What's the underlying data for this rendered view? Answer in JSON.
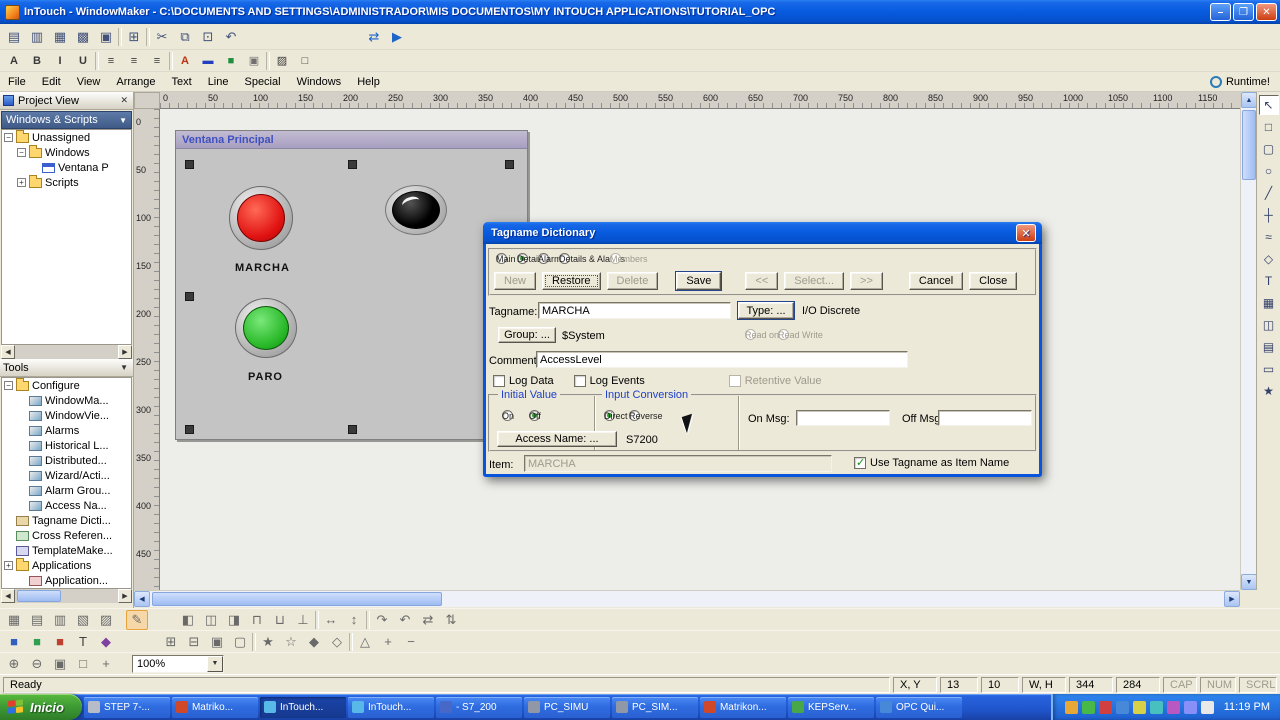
{
  "titlebar": {
    "title": "InTouch - WindowMaker - C:\\DOCUMENTS AND SETTINGS\\ADMINISTRADOR\\MIS DOCUMENTOS\\MY INTOUCH APPLICATIONS\\TUTORIAL_OPC",
    "minimize_glyph": "–",
    "maximize_glyph": "❐",
    "close_glyph": "✕"
  },
  "toolbar1": {
    "icons": [
      {
        "name": "new-window-icon",
        "glyph": "▤"
      },
      {
        "name": "open-window-icon",
        "glyph": "▥"
      },
      {
        "name": "save-window-icon",
        "glyph": "▦"
      },
      {
        "name": "save-all-icon",
        "glyph": "▩"
      },
      {
        "name": "close-window-icon",
        "glyph": "▣"
      },
      {
        "name": "toolbar-separator",
        "sep": true
      },
      {
        "name": "print-icon",
        "glyph": "⊞"
      },
      {
        "name": "toolbar-separator",
        "sep": true
      },
      {
        "name": "cut-icon",
        "glyph": "✂"
      },
      {
        "name": "copy-icon",
        "glyph": "⧉"
      },
      {
        "name": "paste-icon",
        "glyph": "⊡"
      },
      {
        "name": "undo-icon",
        "glyph": "↶"
      },
      {
        "name": "transfer-to-viewer-icon",
        "glyph": "⇄",
        "gap": 120,
        "color": "#1b64c8"
      },
      {
        "name": "runtime-fast-switch-icon",
        "glyph": "▶",
        "color": "#1b64c8"
      }
    ]
  },
  "toolbar2": {
    "icons": [
      {
        "name": "font-icon",
        "glyph": "A"
      },
      {
        "name": "bold-icon",
        "glyph": "B"
      },
      {
        "name": "italic-icon",
        "glyph": "I"
      },
      {
        "name": "underline-icon",
        "glyph": "U"
      },
      {
        "name": "toolbar-separator",
        "sep": true
      },
      {
        "name": "align-left-icon",
        "glyph": "≡"
      },
      {
        "name": "align-center-icon",
        "glyph": "≡"
      },
      {
        "name": "align-right-icon",
        "glyph": "≡"
      },
      {
        "name": "toolbar-separator",
        "sep": true
      },
      {
        "name": "text-color-icon",
        "glyph": "A",
        "color": "#c03010"
      },
      {
        "name": "line-color-icon",
        "glyph": "▬",
        "color": "#2040c0"
      },
      {
        "name": "fill-color-icon",
        "glyph": "■",
        "color": "#209040"
      },
      {
        "name": "window-color-icon",
        "glyph": "▣",
        "color": "#707070"
      },
      {
        "name": "toolbar-separator",
        "sep": true
      },
      {
        "name": "pattern-icon",
        "glyph": "▨"
      },
      {
        "name": "transparent-icon",
        "glyph": "□"
      }
    ]
  },
  "menubar": {
    "items": [
      "File",
      "Edit",
      "View",
      "Arrange",
      "Text",
      "Line",
      "Special",
      "Windows",
      "Help"
    ],
    "runtime_label": "Runtime!"
  },
  "project_view": {
    "title": "Project View",
    "close_glyph": "✕",
    "selector": "Windows & Scripts",
    "items": [
      {
        "label": "Unassigned",
        "indent": 0,
        "icon": "folder",
        "expand": "minus"
      },
      {
        "label": "Windows",
        "indent": 1,
        "icon": "folder",
        "expand": "minus"
      },
      {
        "label": "Ventana P",
        "indent": 2,
        "icon": "window"
      },
      {
        "label": "Scripts",
        "indent": 1,
        "icon": "folder",
        "expand": "plus"
      }
    ]
  },
  "tools_panel": {
    "title": "Tools",
    "items": [
      {
        "label": "Configure",
        "indent": 0,
        "icon": "folder",
        "expand": "minus"
      },
      {
        "label": "WindowMa...",
        "indent": 1,
        "icon": "wizard"
      },
      {
        "label": "WindowVie...",
        "indent": 1,
        "icon": "wizard"
      },
      {
        "label": "Alarms",
        "indent": 1,
        "icon": "wizard"
      },
      {
        "label": "Historical L...",
        "indent": 1,
        "icon": "wizard"
      },
      {
        "label": "Distributed...",
        "indent": 1,
        "icon": "wizard"
      },
      {
        "label": "Wizard/Acti...",
        "indent": 1,
        "icon": "wizard"
      },
      {
        "label": "Alarm Grou...",
        "indent": 1,
        "icon": "wizard"
      },
      {
        "label": "Access Na...",
        "indent": 1,
        "icon": "wizard"
      },
      {
        "label": "Tagname Dicti...",
        "indent": 0,
        "icon": "dict"
      },
      {
        "label": "Cross Referen...",
        "indent": 0,
        "icon": "cross"
      },
      {
        "label": "TemplateMake...",
        "indent": 0,
        "icon": "template"
      },
      {
        "label": "Applications",
        "indent": 0,
        "icon": "folder",
        "expand": "plus"
      },
      {
        "label": "Application...",
        "indent": 1,
        "icon": "app"
      }
    ]
  },
  "ruler_h": [
    "0",
    "50",
    "100",
    "150",
    "200",
    "250",
    "300",
    "350",
    "400",
    "450",
    "500",
    "550",
    "600",
    "650",
    "700",
    "750",
    "800",
    "850",
    "900",
    "950",
    "1000",
    "1050",
    "1100",
    "1150"
  ],
  "ruler_v": [
    "0",
    "50",
    "100",
    "150",
    "200",
    "250",
    "300",
    "350",
    "400",
    "450"
  ],
  "design_window": {
    "title": "Ventana Principal",
    "marcha_label": "MARCHA",
    "paro_label": "PARO"
  },
  "palette": {
    "tools": [
      {
        "name": "select-tool",
        "glyph": "↖",
        "selected": true
      },
      {
        "name": "rectangle-tool",
        "glyph": "□"
      },
      {
        "name": "rounded-rectangle-tool",
        "glyph": "▢"
      },
      {
        "name": "ellipse-tool",
        "glyph": "○"
      },
      {
        "name": "line-tool",
        "glyph": "╱"
      },
      {
        "name": "hv-line-tool",
        "glyph": "┼"
      },
      {
        "name": "polyline-tool",
        "glyph": "≈"
      },
      {
        "name": "polygon-tool",
        "glyph": "◇"
      },
      {
        "name": "text-tool",
        "glyph": "T"
      },
      {
        "name": "bitmap-tool",
        "glyph": "▦"
      },
      {
        "name": "real-time-trend-tool",
        "glyph": "◫"
      },
      {
        "name": "historical-trend-tool",
        "glyph": "▤"
      },
      {
        "name": "button-tool",
        "glyph": "▭"
      },
      {
        "name": "wizard-tool",
        "glyph": "★"
      }
    ]
  },
  "dialog": {
    "title": "Tagname Dictionary",
    "close_glyph": "✕",
    "view_radios": [
      {
        "name": "main-radio",
        "label": "Main"
      },
      {
        "name": "details-radio",
        "label": "Details",
        "selected": true
      },
      {
        "name": "alarms-radio",
        "label": "Alarms"
      },
      {
        "name": "details-alarms-radio",
        "label": "Details & Alarms"
      },
      {
        "name": "members-radio",
        "label": "Members",
        "disabled": true,
        "gap": 30
      }
    ],
    "action_buttons": [
      {
        "name": "new-button",
        "label": "New",
        "disabled": true
      },
      {
        "name": "restore-button",
        "label": "Restore",
        "focus": true
      },
      {
        "name": "delete-button",
        "label": "Delete",
        "disabled": true
      },
      {
        "name": "save-button",
        "label": "Save",
        "default": true,
        "gap": 12
      },
      {
        "name": "prev-button",
        "label": "<<",
        "disabled": true,
        "gap": 18
      },
      {
        "name": "select-button",
        "label": "Select...",
        "disabled": true
      },
      {
        "name": "next-button",
        "label": ">>",
        "disabled": true
      },
      {
        "name": "cancel-button",
        "label": "Cancel",
        "gap": 20
      },
      {
        "name": "close-button",
        "label": "Close"
      }
    ],
    "tagname_label": "Tagname:",
    "tagname_value": "MARCHA",
    "type_button_label": "Type: ...",
    "type_value": "I/O Discrete",
    "group_button_label": "Group: ...",
    "group_value": "$System",
    "access_radios": [
      {
        "name": "read-only-radio",
        "label": "Read only",
        "disabled": true
      },
      {
        "name": "read-write-radio",
        "label": "Read Write",
        "disabled": true
      }
    ],
    "comment_label": "Comment:",
    "comment_value": "AccessLevel",
    "flag_checkboxes": [
      {
        "name": "log-data-checkbox",
        "label": "Log Data"
      },
      {
        "name": "log-events-checkbox",
        "label": "Log Events"
      },
      {
        "name": "retentive-value-checkbox",
        "label": "Retentive Value",
        "disabled": true,
        "gap": 64
      }
    ],
    "initial_value_label": "Initial Value",
    "initial_radios": [
      {
        "name": "on-radio",
        "label": "On"
      },
      {
        "name": "off-radio",
        "label": "Off",
        "selected": true
      }
    ],
    "input_conversion_label": "Input Conversion",
    "conversion_radios": [
      {
        "name": "direct-radio",
        "label": "Direct",
        "selected": true
      },
      {
        "name": "reverse-radio",
        "label": "Reverse"
      }
    ],
    "on_msg_label": "On Msg:",
    "on_msg_value": "",
    "off_msg_label": "Off Msg:",
    "off_msg_value": "",
    "access_name_button_label": "Access Name: ...",
    "access_name_value": "S7200",
    "item_label": "Item:",
    "item_value": "MARCHA",
    "use_tagname_label": "Use Tagname as Item Name"
  },
  "bottom_toolbar1": {
    "icons": [
      {
        "name": "snap-grid-icon",
        "glyph": "▦"
      },
      {
        "name": "grid-icon",
        "glyph": "▤"
      },
      {
        "name": "ruler-toggle-icon",
        "glyph": "▥"
      },
      {
        "name": "guides-icon",
        "glyph": "▧"
      },
      {
        "name": "layout-icon",
        "glyph": "▨"
      },
      {
        "name": "wizard-edit-icon",
        "glyph": "✎",
        "hl": true,
        "gap": 8
      },
      {
        "name": "align-left-icon",
        "glyph": "◧",
        "gap": 28
      },
      {
        "name": "align-center-icon",
        "glyph": "◫"
      },
      {
        "name": "align-right-icon",
        "glyph": "◨"
      },
      {
        "name": "align-top-icon",
        "glyph": "⊓"
      },
      {
        "name": "align-middle-icon",
        "glyph": "⊔"
      },
      {
        "name": "align-bottom-icon",
        "glyph": "⊥"
      },
      {
        "name": "toolbar-separator",
        "sep": true
      },
      {
        "name": "space-horizontal-icon",
        "glyph": "↔"
      },
      {
        "name": "space-vertical-icon",
        "glyph": "↕"
      },
      {
        "name": "toolbar-separator",
        "sep": true
      },
      {
        "name": "rotate-cw-icon",
        "glyph": "↷"
      },
      {
        "name": "rotate-ccw-icon",
        "glyph": "↶"
      },
      {
        "name": "flip-horizontal-icon",
        "glyph": "⇄"
      },
      {
        "name": "flip-vertical-icon",
        "glyph": "⇅"
      }
    ]
  },
  "bottom_toolbar2": {
    "icons": [
      {
        "name": "draw-mode-icon",
        "glyph": "■",
        "color": "#3060c0"
      },
      {
        "name": "fill-mode-icon",
        "glyph": "■",
        "color": "#30a050"
      },
      {
        "name": "line-mode-icon",
        "glyph": "■",
        "color": "#c04030"
      },
      {
        "name": "text-mode-icon",
        "glyph": "T",
        "color": "#404040"
      },
      {
        "name": "object-mode-icon",
        "glyph": "◆",
        "color": "#8040a0"
      },
      {
        "name": "bring-to-front-icon",
        "glyph": "⊞",
        "gap": 42
      },
      {
        "name": "send-to-back-icon",
        "glyph": "⊟"
      },
      {
        "name": "group-symbol-icon",
        "glyph": "▣"
      },
      {
        "name": "ungroup-symbol-icon",
        "glyph": "▢"
      },
      {
        "name": "toolbar-separator",
        "sep": true
      },
      {
        "name": "make-symbol-icon",
        "glyph": "★"
      },
      {
        "name": "break-symbol-icon",
        "glyph": "☆"
      },
      {
        "name": "make-cell-icon",
        "glyph": "◆"
      },
      {
        "name": "break-cell-icon",
        "glyph": "◇"
      },
      {
        "name": "toolbar-separator",
        "sep": true
      },
      {
        "name": "reshape-icon",
        "glyph": "△"
      },
      {
        "name": "add-point-icon",
        "glyph": "+"
      },
      {
        "name": "delete-point-icon",
        "glyph": "−"
      }
    ]
  },
  "zoom_toolbar": {
    "icons": [
      {
        "name": "zoom-in-icon",
        "glyph": "⊕"
      },
      {
        "name": "zoom-out-icon",
        "glyph": "⊖"
      },
      {
        "name": "zoom-selection-icon",
        "glyph": "▣"
      },
      {
        "name": "zoom-page-icon",
        "glyph": "□"
      },
      {
        "name": "pan-icon",
        "glyph": "+"
      }
    ],
    "zoom_value": "100%"
  },
  "statusbar": {
    "ready": "Ready",
    "xy_label": "X, Y",
    "x": "13",
    "y": "10",
    "wh_label": "W, H",
    "w": "344",
    "h": "284",
    "cap": "CAP",
    "num": "NUM",
    "scrl": "SCRL"
  },
  "taskbar": {
    "start_label": "Inicio",
    "tasks": [
      {
        "name": "task-step7",
        "label": "STEP 7-...",
        "color": "#b8bcc8"
      },
      {
        "name": "task-matrikon-1",
        "label": "Matriko...",
        "color": "#d04828"
      },
      {
        "name": "task-intouch-windowmaker",
        "label": "InTouch...",
        "color": "#58b8e8",
        "pressed": true
      },
      {
        "name": "task-intouch-2",
        "label": "InTouch...",
        "color": "#58b8e8"
      },
      {
        "name": "task-s7-200",
        "label": "- S7_200",
        "color": "#4868c8"
      },
      {
        "name": "task-pc-simu",
        "label": "PC_SIMU",
        "color": "#9098a8"
      },
      {
        "name": "task-pc-sim",
        "label": "PC_SIM...",
        "color": "#9098a8"
      },
      {
        "name": "task-matrikon-2",
        "label": "Matrikon...",
        "color": "#d04828"
      },
      {
        "name": "task-kepserver",
        "label": "KEPServ...",
        "color": "#48a848"
      },
      {
        "name": "task-opc-quick",
        "label": "OPC Qui...",
        "color": "#4888d8"
      }
    ],
    "tray_icons": [
      {
        "name": "tray-icon-1",
        "color": "#e8a838"
      },
      {
        "name": "tray-icon-2",
        "color": "#48b848"
      },
      {
        "name": "tray-icon-3",
        "color": "#d04040"
      },
      {
        "name": "tray-icon-4",
        "color": "#4888d8"
      },
      {
        "name": "tray-icon-5",
        "color": "#d8d048"
      },
      {
        "name": "tray-icon-6",
        "color": "#48c0c0"
      },
      {
        "name": "tray-icon-7",
        "color": "#b858c0"
      },
      {
        "name": "tray-icon-8",
        "color": "#8890f8"
      },
      {
        "name": "tray-icon-9",
        "color": "#e8e8e8"
      }
    ],
    "time": "11:19 PM"
  }
}
